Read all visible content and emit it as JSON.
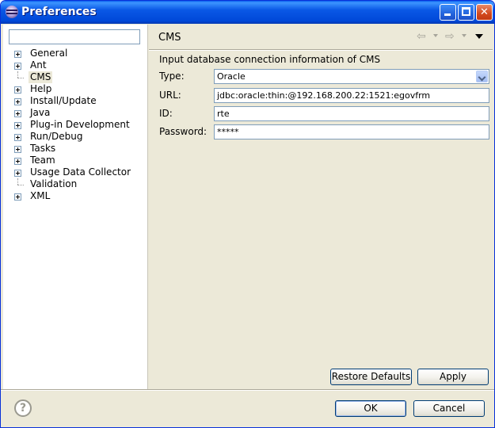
{
  "window": {
    "title": "Preferences",
    "controls": {
      "minimize": "minimize",
      "maximize": "maximize",
      "close": "close"
    }
  },
  "sidebar": {
    "filter_value": "",
    "items": [
      {
        "label": "General",
        "expandable": true
      },
      {
        "label": "Ant",
        "expandable": true
      },
      {
        "label": "CMS",
        "expandable": false,
        "selected": true
      },
      {
        "label": "Help",
        "expandable": true
      },
      {
        "label": "Install/Update",
        "expandable": true
      },
      {
        "label": "Java",
        "expandable": true
      },
      {
        "label": "Plug-in Development",
        "expandable": true
      },
      {
        "label": "Run/Debug",
        "expandable": true
      },
      {
        "label": "Tasks",
        "expandable": true
      },
      {
        "label": "Team",
        "expandable": true
      },
      {
        "label": "Usage Data Collector",
        "expandable": true
      },
      {
        "label": "Validation",
        "expandable": false
      },
      {
        "label": "XML",
        "expandable": true
      }
    ]
  },
  "page": {
    "title": "CMS",
    "description": "Input database connection information of CMS",
    "fields": {
      "type": {
        "label": "Type:",
        "value": "Oracle"
      },
      "url": {
        "label": "URL:",
        "value": "jdbc:oracle:thin:@192.168.200.22:1521:egovfrm"
      },
      "id": {
        "label": "ID:",
        "value": "rte"
      },
      "password": {
        "label": "Password:",
        "value": "*****"
      }
    },
    "buttons": {
      "restore_defaults": "Restore Defaults",
      "apply": "Apply"
    }
  },
  "footer": {
    "ok": "OK",
    "cancel": "Cancel"
  },
  "icons": {
    "help": "help-icon",
    "back": "back-arrow-icon",
    "forward": "forward-arrow-icon",
    "view_menu": "view-menu-icon"
  },
  "colors": {
    "titlebar": "#0a58e6",
    "dialog_bg": "#ece9d8",
    "button_border": "#003c74"
  }
}
